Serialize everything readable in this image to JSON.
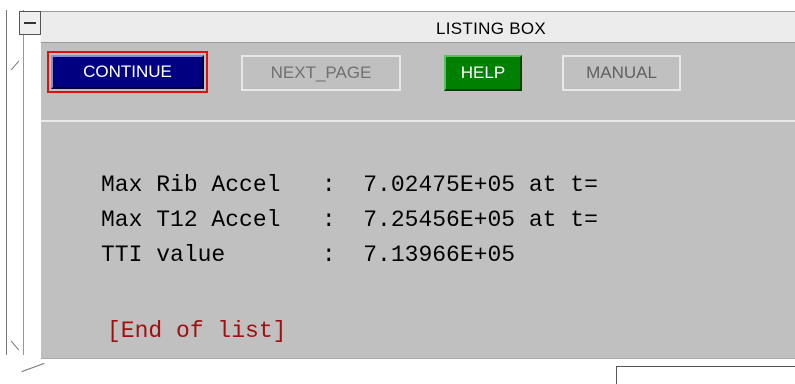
{
  "window": {
    "title": "LISTING BOX"
  },
  "buttons": {
    "continue": "CONTINUE",
    "next_page": "NEXT_PAGE",
    "help": "HELP",
    "manual": "MANUAL"
  },
  "listing": {
    "lines": [
      "Max Rib Accel   :  7.02475E+05 at t=",
      "Max T12 Accel   :  7.25456E+05 at t=",
      "TTI value       :  7.13966E+05"
    ],
    "end": "[End of list]"
  },
  "colors": {
    "continue_bg": "#000080",
    "continue_focus_border": "#e01010",
    "help_bg": "#008000",
    "panel_bg": "#c0c0c0",
    "end_text": "#a01010"
  }
}
